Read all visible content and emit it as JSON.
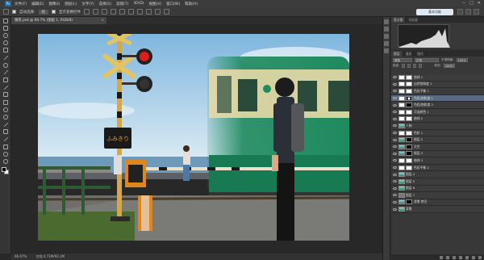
{
  "menubar": {
    "logo": "Ps",
    "items": [
      "文件(F)",
      "编辑(E)",
      "图像(I)",
      "图层(L)",
      "文字(Y)",
      "选择(S)",
      "滤镜(T)",
      "3D(D)",
      "视图(V)",
      "窗口(W)",
      "帮助(H)"
    ],
    "window_controls": [
      "−",
      "□",
      "✕"
    ]
  },
  "options": {
    "auto_select_label": "自动选择:",
    "group_value": "组",
    "show_transform_label": "显示变换控件",
    "workspace": "基本功能"
  },
  "document": {
    "tab_label": "湘南.psd @ 66.7% (图层 1, RGB/8)",
    "close": "×",
    "zoom": "66.67%",
    "doc_info": "文档:4.71M/93.1M"
  },
  "panels": {
    "histogram_tabs": [
      "直方图",
      "导航器"
    ],
    "layers_tabs": [
      "图层",
      "通道",
      "路径"
    ],
    "kind_label": "类型",
    "blend_mode": "正常",
    "opacity_label": "不透明度:",
    "opacity_value": "100%",
    "lock_label": "锁定:",
    "fill_label": "填充:",
    "fill_value": "100%"
  },
  "layers": [
    {
      "name": "曲线 1",
      "thumb": "t-w",
      "mask": "w",
      "selected": false
    },
    {
      "name": "自然饱和度 1",
      "thumb": "t-w",
      "mask": "w",
      "selected": false
    },
    {
      "name": "色彩平衡 1",
      "thumb": "t-w",
      "mask": "w",
      "selected": false
    },
    {
      "name": "色相/饱和度 1",
      "thumb": "t-w",
      "mask": "m",
      "selected": true
    },
    {
      "name": "色相/饱和度 2",
      "thumb": "t-w",
      "mask": "k",
      "selected": false
    },
    {
      "name": "可选颜色 1",
      "thumb": "t-w",
      "mask": "w",
      "selected": false
    },
    {
      "name": "曲线 2",
      "thumb": "t-w",
      "mask": "w",
      "selected": false
    },
    {
      "name": "人物",
      "thumb": "t-p",
      "mask": "",
      "selected": false
    },
    {
      "name": "色阶 1",
      "thumb": "t-w",
      "mask": "w",
      "selected": false
    },
    {
      "name": "图层 2",
      "thumb": "t-p",
      "mask": "k",
      "selected": false
    },
    {
      "name": "天空",
      "thumb": "t-p",
      "mask": "k",
      "selected": false
    },
    {
      "name": "图层 3",
      "thumb": "t-p",
      "mask": "k",
      "selected": false
    },
    {
      "name": "曲线 3",
      "thumb": "t-w",
      "mask": "w",
      "selected": false
    },
    {
      "name": "色彩平衡 2",
      "thumb": "t-w",
      "mask": "w",
      "selected": false
    },
    {
      "name": "图层 4",
      "thumb": "t-p",
      "mask": "",
      "selected": false
    },
    {
      "name": "图层 5",
      "thumb": "t-p",
      "mask": "",
      "selected": false
    },
    {
      "name": "图层 6",
      "thumb": "t-p",
      "mask": "",
      "selected": false
    },
    {
      "name": "图层 7",
      "thumb": "t-g",
      "mask": "",
      "selected": false
    },
    {
      "name": "背景 拷贝",
      "thumb": "t-p",
      "mask": "k",
      "selected": false
    },
    {
      "name": "背景",
      "thumb": "t-p",
      "mask": "",
      "selected": false
    }
  ],
  "photo": {
    "crossing_sign": "ふみきり",
    "colors": {
      "sky_top": "#7fb6de",
      "sky_bottom": "#dcecf4",
      "sea": "#6f99b8",
      "train_green": "#1f8a5e",
      "train_cream": "#e8d9a8",
      "ground": "#6e6e6a",
      "grass": "#4a6a30"
    }
  }
}
